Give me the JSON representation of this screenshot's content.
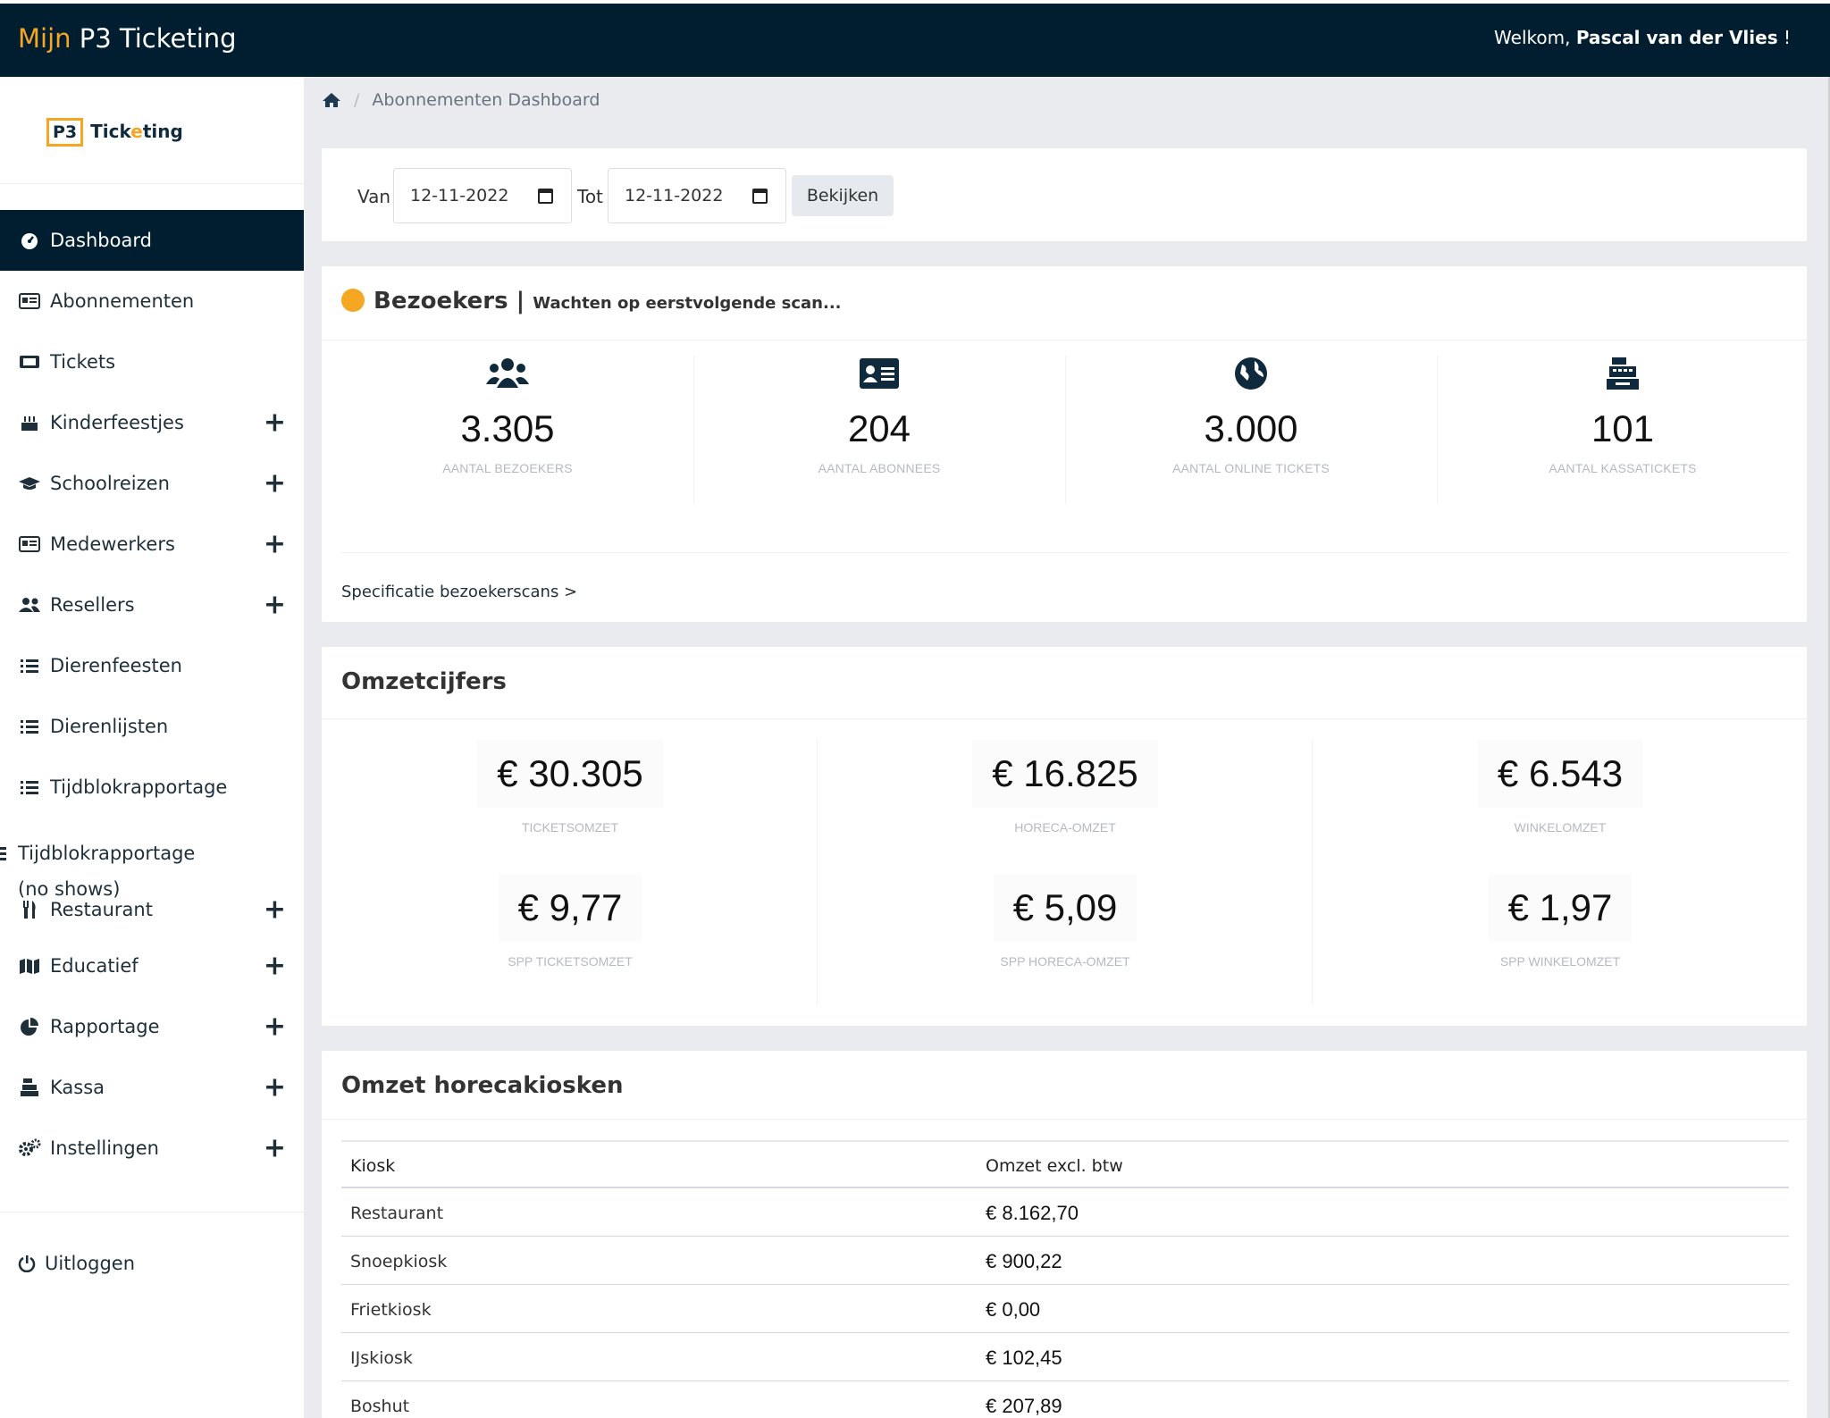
{
  "topbar": {
    "brand_prefix": "Mijn",
    "brand_name": "P3 Ticketing",
    "welcome_prefix": "Welkom,",
    "user_name": "Pascal van der Vlies",
    "welcome_suffix": "!"
  },
  "logo": {
    "bracket_text": "P3",
    "part1": "Tick",
    "part2": "e",
    "part3": "ting"
  },
  "sidebar": {
    "items": [
      {
        "label": "Dashboard",
        "icon": "gauge-icon",
        "expandable": false,
        "active": true
      },
      {
        "label": "Abonnementen",
        "icon": "id-card-icon",
        "expandable": false
      },
      {
        "label": "Tickets",
        "icon": "ticket-icon",
        "expandable": false
      },
      {
        "label": "Kinderfeestjes",
        "icon": "cake-icon",
        "expandable": true
      },
      {
        "label": "Schoolreizen",
        "icon": "graduation-cap-icon",
        "expandable": true
      },
      {
        "label": "Medewerkers",
        "icon": "id-card-icon",
        "expandable": true
      },
      {
        "label": "Resellers",
        "icon": "users-icon",
        "expandable": true
      },
      {
        "label": "Dierenfeesten",
        "icon": "list-icon",
        "expandable": false
      },
      {
        "label": "Dierenlijsten",
        "icon": "list-icon",
        "expandable": false
      },
      {
        "label": "Tijdblokrapportage",
        "icon": "list-icon",
        "expandable": false
      },
      {
        "label": "Tijdblokrapportage (no shows)",
        "icon": "list-icon",
        "expandable": false
      },
      {
        "label": "Restaurant",
        "icon": "utensils-icon",
        "expandable": true
      },
      {
        "label": "Educatief",
        "icon": "map-icon",
        "expandable": true
      },
      {
        "label": "Rapportage",
        "icon": "pie-chart-icon",
        "expandable": true
      },
      {
        "label": "Kassa",
        "icon": "cash-register-icon",
        "expandable": true
      },
      {
        "label": "Instellingen",
        "icon": "cogs-icon",
        "expandable": true
      }
    ],
    "logout_label": "Uitloggen",
    "plus_symbol": "+"
  },
  "breadcrumb": {
    "current": "Abonnementen Dashboard",
    "separator": "/"
  },
  "filter": {
    "from_label": "Van",
    "from_value": "12-11-2022",
    "to_label": "Tot",
    "to_value": "12-11-2022",
    "submit_label": "Bekijken"
  },
  "visitors": {
    "title": "Bezoekers",
    "divider": "|",
    "status": "Wachten op eerstvolgende scan...",
    "status_color": "#f5a623",
    "stats": [
      {
        "value": "3.305",
        "label": "AANTAL BEZOEKERS",
        "icon": "users-icon"
      },
      {
        "value": "204",
        "label": "AANTAL ABONNEES",
        "icon": "id-card-icon"
      },
      {
        "value": "3.000",
        "label": "AANTAL ONLINE TICKETS",
        "icon": "globe-icon"
      },
      {
        "value": "101",
        "label": "AANTAL KASSATICKETS",
        "icon": "cash-register-icon"
      }
    ],
    "spec_link": "Specificatie bezoekerscans >"
  },
  "omzet": {
    "title": "Omzetcijfers",
    "items": [
      {
        "value": "€ 30.305",
        "label": "TICKETSOMZET"
      },
      {
        "value": "€ 16.825",
        "label": "HORECA-OMZET"
      },
      {
        "value": "€ 6.543",
        "label": "WINKELOMZET"
      },
      {
        "value": "€ 9,77",
        "label": "SPP TICKETSOMZET"
      },
      {
        "value": "€ 5,09",
        "label": "SPP HORECA-OMZET"
      },
      {
        "value": "€ 1,97",
        "label": "SPP WINKELOMZET"
      }
    ]
  },
  "kiosks": {
    "title": "Omzet horecakiosken",
    "headers": [
      "Kiosk",
      "Omzet excl. btw"
    ],
    "rows": [
      {
        "name": "Restaurant",
        "amount": "€ 8.162,70"
      },
      {
        "name": "Snoepkiosk",
        "amount": "€ 900,22"
      },
      {
        "name": "Frietkiosk",
        "amount": "€ 0,00"
      },
      {
        "name": "IJskiosk",
        "amount": "€ 102,45"
      },
      {
        "name": "Boshut",
        "amount": "€ 207,89"
      }
    ]
  },
  "colors": {
    "navy": "#011e30",
    "accent": "#f5a623"
  }
}
